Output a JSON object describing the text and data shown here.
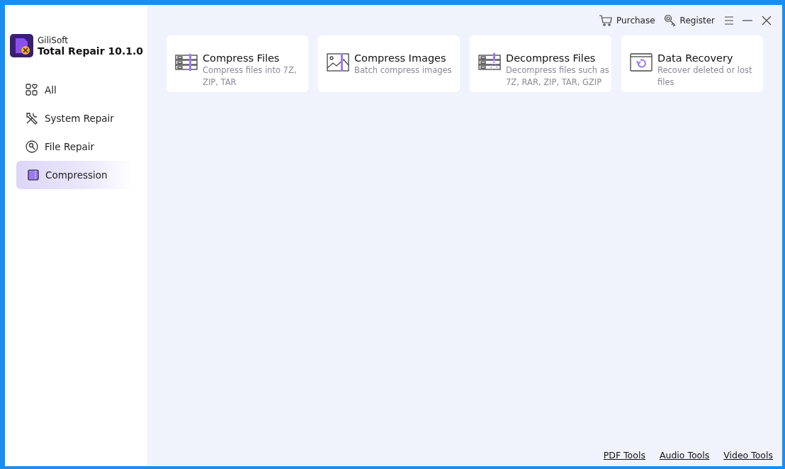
{
  "app": {
    "vendor": "GiliSoft",
    "title": "Total Repair 10.1.0"
  },
  "sidebar": {
    "items": [
      {
        "label": "All",
        "kind": "all",
        "selected": false
      },
      {
        "label": "System Repair",
        "kind": "system",
        "selected": false
      },
      {
        "label": "File Repair",
        "kind": "file",
        "selected": false
      },
      {
        "label": "Compression",
        "kind": "compression",
        "selected": true
      }
    ]
  },
  "header": {
    "purchase": "Purchase",
    "register": "Register"
  },
  "tools": [
    {
      "kind": "compress-files",
      "title": "Compress Files",
      "description": "Compress files into 7Z, ZIP, TAR"
    },
    {
      "kind": "compress-images",
      "title": "Compress Images",
      "description": "Batch compress images"
    },
    {
      "kind": "decompress-files",
      "title": "Decompress Files",
      "description": "Decompress files such as 7Z, RAR, ZIP, TAR, GZIP"
    },
    {
      "kind": "data-recovery",
      "title": "Data Recovery",
      "description": "Recover deleted or lost files"
    }
  ],
  "footer_links": [
    "PDF Tools",
    "Audio Tools",
    "Video Tools"
  ]
}
